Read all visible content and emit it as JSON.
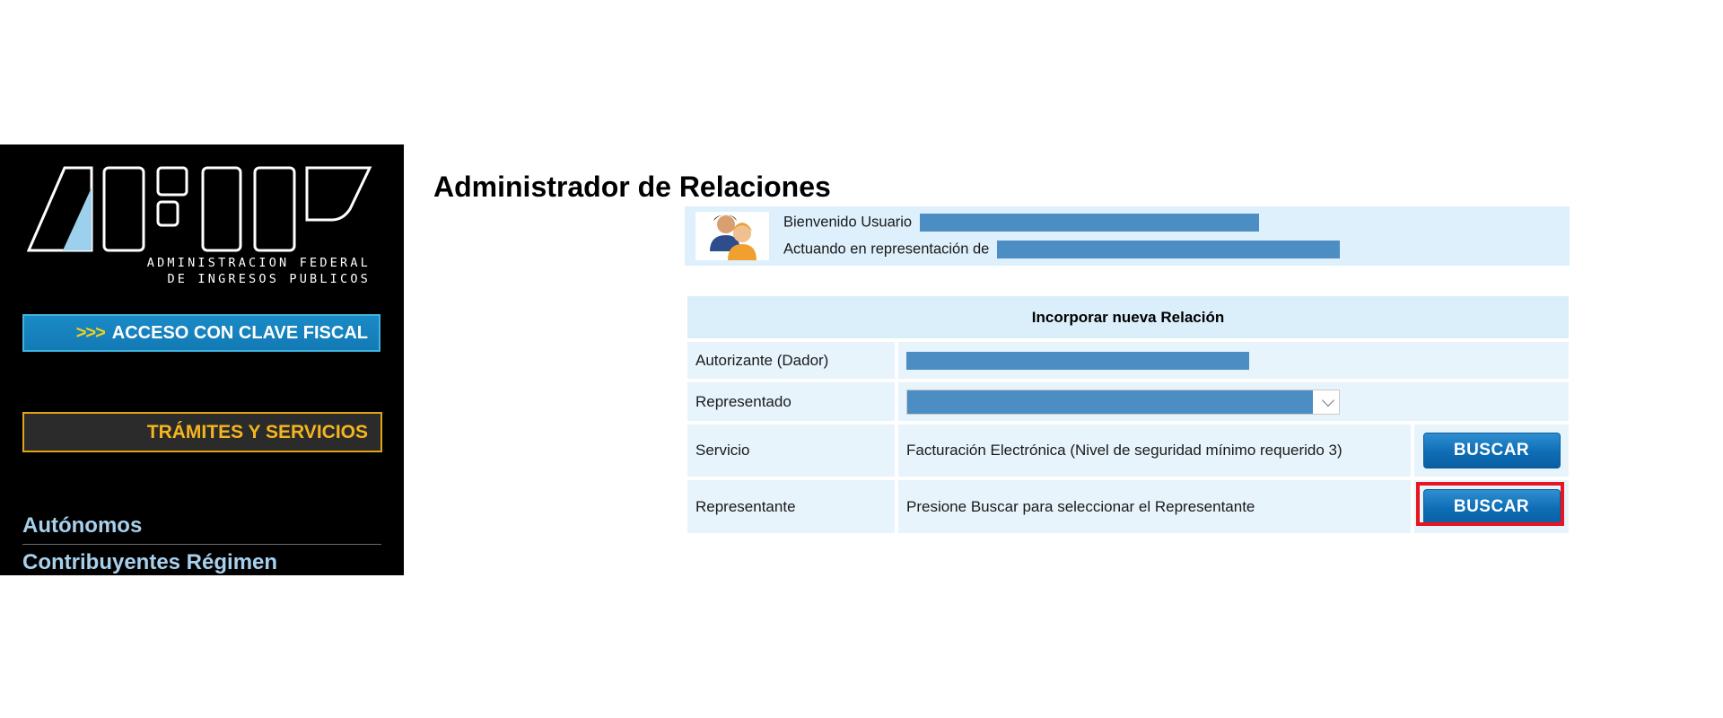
{
  "sidebar": {
    "logo_text": "AFIP",
    "agency_line1": "ADMINISTRACION FEDERAL",
    "agency_line2": "DE INGRESOS PUBLICOS",
    "access_chevrons": ">>>",
    "access_label": "ACCESO CON CLAVE FISCAL",
    "tramites_label": "TRÁMITES Y SERVICIOS",
    "nav": [
      {
        "label": "Autónomos"
      },
      {
        "label": "Contribuyentes Régimen"
      }
    ]
  },
  "page": {
    "title": "Administrador de Relaciones"
  },
  "welcome": {
    "user_label": "Bienvenido Usuario",
    "representation_label": "Actuando en representación de"
  },
  "form": {
    "header": "Incorporar nueva Relación",
    "rows": [
      {
        "label": "Autorizante (Dador)"
      },
      {
        "label": "Representado"
      },
      {
        "label": "Servicio",
        "value": "Facturación Electrónica (Nivel de seguridad mínimo requerido 3)",
        "button": "BUSCAR"
      },
      {
        "label": "Representante",
        "value": "Presione Buscar para seleccionar el Representante",
        "button": "BUSCAR"
      }
    ]
  },
  "colors": {
    "redaction": "#4c8ec3",
    "header_bg": "#dbeffb",
    "button_blue": "#0e6db5",
    "highlight": "#e8141f"
  }
}
